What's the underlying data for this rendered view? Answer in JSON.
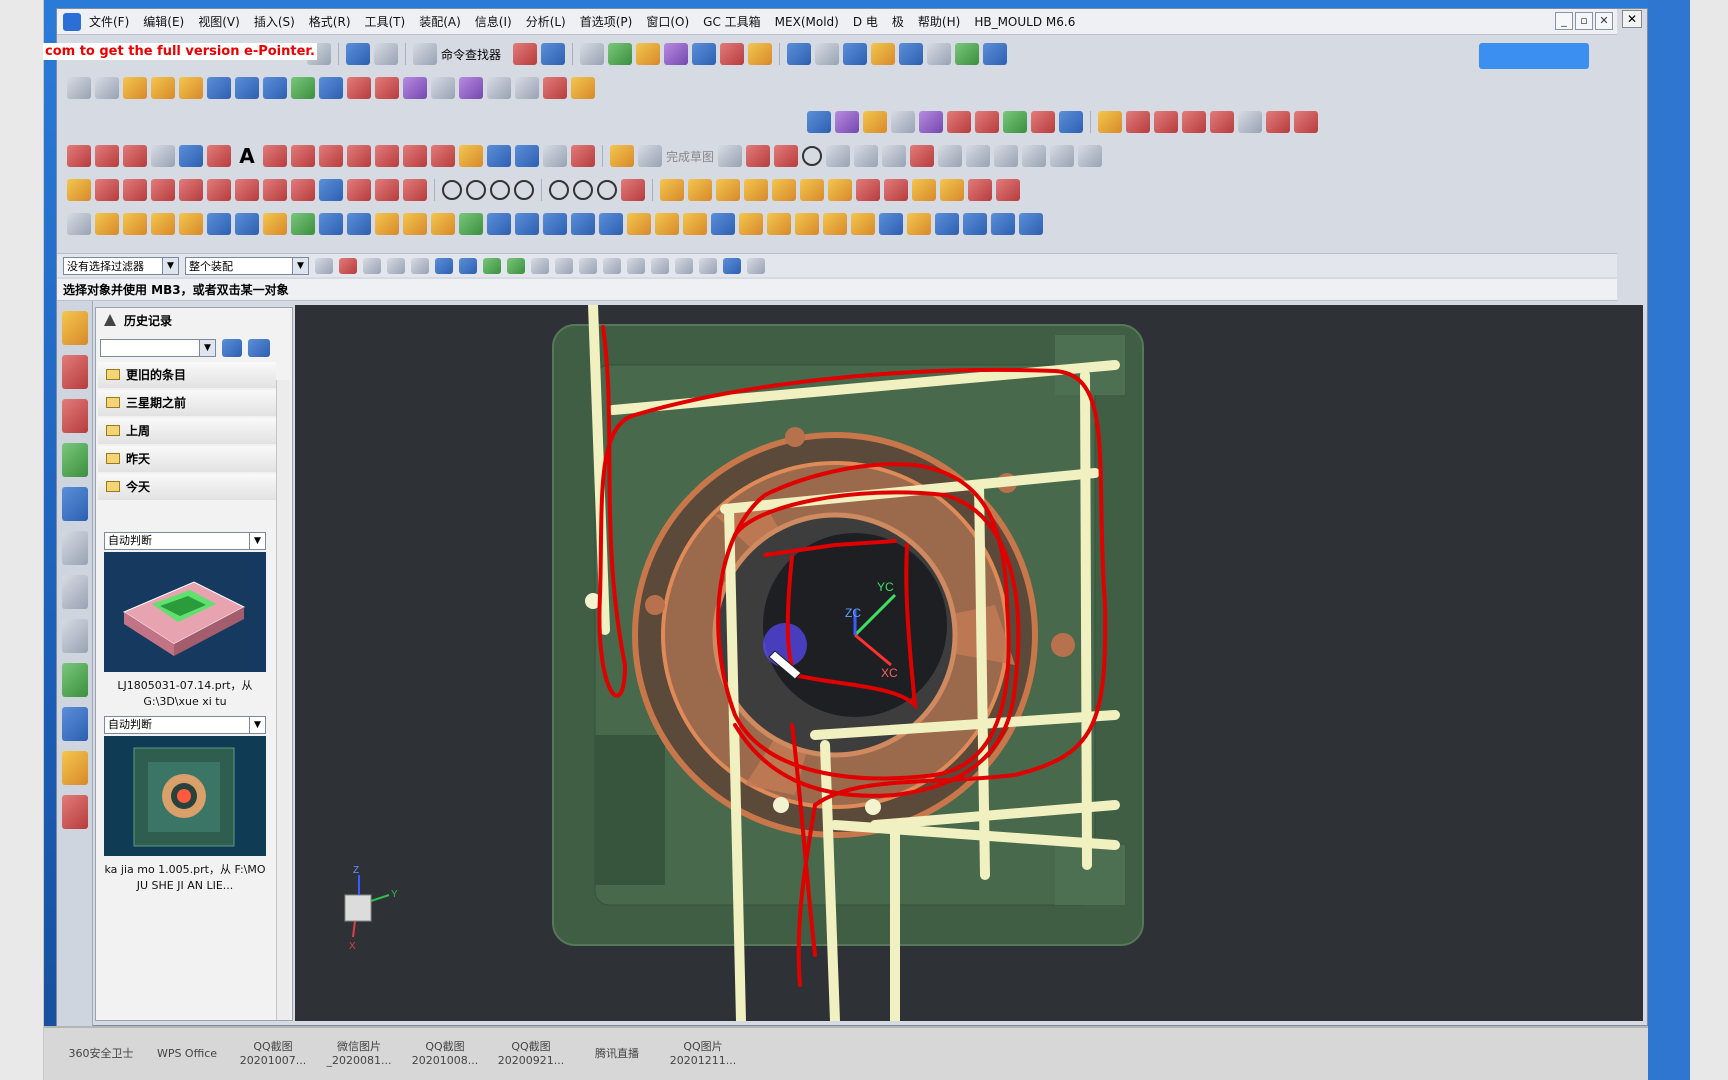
{
  "menu": {
    "items": [
      "文件(F)",
      "编辑(E)",
      "视图(V)",
      "插入(S)",
      "格式(R)",
      "工具(T)",
      "装配(A)",
      "信息(I)",
      "分析(L)",
      "首选项(P)",
      "窗口(O)",
      "GC 工具箱",
      "MEX(Mold)",
      "D 电",
      "极",
      "帮助(H)",
      "HB_MOULD M6.6"
    ]
  },
  "toolbar": {
    "command_finder": "命令查找器",
    "sketch_finish": "完成草图"
  },
  "promo_text": "com to get the full version e-Pointer.",
  "filter": {
    "selection_filter": "没有选择过滤器",
    "scope": "整个装配"
  },
  "status_prompt": "选择对象并使用 MB3，或者双击某一对象",
  "history": {
    "title": "历史记录",
    "groups": [
      "更旧的条目",
      "三星期之前",
      "上周",
      "昨天",
      "今天"
    ],
    "thumbnails": [
      {
        "mode": "自动判断",
        "caption": "LJ1805031-07.14.prt，从 G:\\3D\\xue xi tu"
      },
      {
        "mode": "自动判断",
        "caption": "ka jia mo 1.005.prt，从 F:\\MO JU SHE JI AN LIE..."
      }
    ]
  },
  "viewport": {
    "axis_labels": {
      "yc": "YC",
      "zc": "ZC",
      "xc": "XC"
    },
    "triad_labels": {
      "y": "Y",
      "z": "Z",
      "x": "X"
    }
  },
  "taskbar": {
    "items": [
      {
        "line1": "360安全卫士",
        "line2": ""
      },
      {
        "line1": "WPS Office",
        "line2": ""
      },
      {
        "line1": "QQ截图",
        "line2": "20201007..."
      },
      {
        "line1": "微信图片",
        "line2": "_2020081..."
      },
      {
        "line1": "QQ截图",
        "line2": "20201008..."
      },
      {
        "line1": "QQ截图",
        "line2": "20200921..."
      },
      {
        "line1": "腾讯直播",
        "line2": ""
      },
      {
        "line1": "QQ图片",
        "line2": "20201211..."
      }
    ]
  },
  "colors": {
    "viewport_bg": "#2e3236",
    "mold_green": "#3f5e44",
    "pipe": "#f1f0c0",
    "annotation": "#e00000",
    "copper": "#c8774a"
  }
}
